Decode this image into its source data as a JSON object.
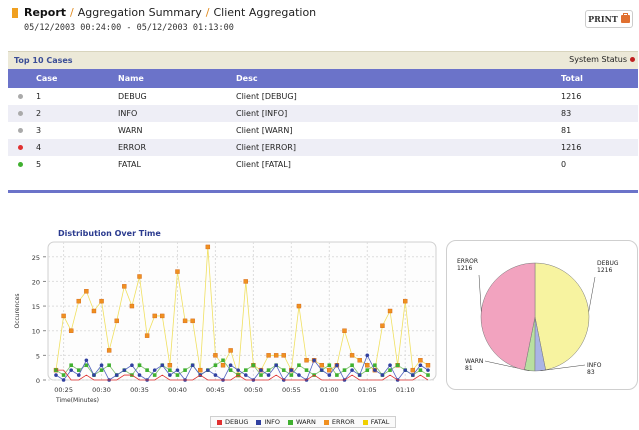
{
  "header": {
    "report_label": "Report",
    "crumb1": "Aggregation Summary",
    "crumb2": "Client Aggregation",
    "date_range": "05/12/2003 00:24:00 - 05/12/2003 01:13:00",
    "print_label": "PRINT",
    "accent_color": "#e08a1e"
  },
  "top_panel": {
    "title": "Top 10 Cases",
    "system_status_label": "System Status",
    "columns": [
      "Case",
      "Name",
      "Desc",
      "Total"
    ],
    "rows": [
      {
        "case": "1",
        "name": "DEBUG",
        "desc": "Client [DEBUG]",
        "total": "1216",
        "status_color": "#aaaaaa"
      },
      {
        "case": "2",
        "name": "INFO",
        "desc": "Client [INFO]",
        "total": "83",
        "status_color": "#aaaaaa"
      },
      {
        "case": "3",
        "name": "WARN",
        "desc": "Client [WARN]",
        "total": "81",
        "status_color": "#aaaaaa"
      },
      {
        "case": "4",
        "name": "ERROR",
        "desc": "Client [ERROR]",
        "total": "1216",
        "status_color": "#e03030"
      },
      {
        "case": "5",
        "name": "FATAL",
        "desc": "Client [FATAL]",
        "total": "0",
        "status_color": "#40b030"
      }
    ]
  },
  "charts_section": {
    "dist_title": "Distribution Over Time"
  },
  "chart_data": [
    {
      "type": "line",
      "title": "Distribution Over Time",
      "xlabel": "Time(Minutes)",
      "ylabel": "Occurences",
      "x_ticks": [
        "00:25",
        "00:30",
        "00:35",
        "00:40",
        "00:45",
        "00:50",
        "00:55",
        "01:00",
        "01:05",
        "01:10"
      ],
      "y_ticks": [
        0,
        5,
        10,
        15,
        20,
        25
      ],
      "ylim": [
        0,
        28
      ],
      "xlim": [
        0,
        49
      ],
      "grid": true,
      "legend_placement": "bottom",
      "series": [
        {
          "name": "DEBUG",
          "color": "#e03030",
          "values": [
            2,
            2,
            0,
            0,
            1,
            0,
            0,
            0,
            0,
            1,
            1,
            0,
            0,
            0,
            1,
            0,
            0,
            0,
            0,
            1,
            0,
            0,
            0,
            0,
            1,
            0,
            0,
            0,
            0,
            1,
            0,
            0,
            0,
            0,
            1,
            0,
            0,
            0,
            0,
            1,
            0,
            0,
            0,
            0,
            1,
            0,
            0,
            0,
            1,
            0
          ]
        },
        {
          "name": "INFO",
          "color": "#3040a0",
          "values": [
            1,
            0,
            2,
            1,
            4,
            1,
            3,
            0,
            1,
            2,
            3,
            1,
            0,
            2,
            3,
            1,
            2,
            0,
            3,
            1,
            2,
            1,
            0,
            3,
            2,
            1,
            0,
            2,
            1,
            3,
            0,
            2,
            1,
            0,
            4,
            2,
            1,
            3,
            0,
            2,
            1,
            5,
            2,
            1,
            3,
            0,
            2,
            1,
            3,
            2
          ]
        },
        {
          "name": "WARN",
          "color": "#40b030",
          "values": [
            2,
            1,
            3,
            2,
            3,
            1,
            2,
            3,
            1,
            2,
            1,
            3,
            2,
            1,
            3,
            2,
            1,
            2,
            3,
            1,
            2,
            3,
            4,
            2,
            1,
            2,
            3,
            1,
            2,
            3,
            2,
            1,
            3,
            2,
            1,
            2,
            3,
            1,
            2,
            3,
            1,
            2,
            3,
            1,
            2,
            3,
            2,
            1,
            2,
            1
          ]
        },
        {
          "name": "ERROR",
          "color": "#f09020",
          "values": [
            2,
            13,
            10,
            16,
            18,
            14,
            16,
            6,
            12,
            19,
            15,
            21,
            9,
            13,
            13,
            3,
            22,
            12,
            12,
            2,
            27,
            5,
            3,
            6,
            1,
            20,
            3,
            2,
            5,
            5,
            5,
            2,
            15,
            4,
            4,
            3,
            2,
            3,
            10,
            5,
            4,
            3,
            2,
            11,
            14,
            3,
            16,
            2,
            4,
            3
          ]
        },
        {
          "name": "FATAL",
          "color": "#f0d000",
          "values": [
            0,
            0,
            0,
            0,
            0,
            0,
            0,
            0,
            0,
            0,
            0,
            0,
            0,
            0,
            0,
            0,
            0,
            0,
            0,
            0,
            0,
            0,
            0,
            0,
            0,
            0,
            0,
            0,
            0,
            0,
            0,
            0,
            0,
            0,
            0,
            0,
            0,
            0,
            0,
            0,
            0,
            0,
            0,
            0,
            0,
            0,
            0,
            0,
            0,
            0
          ]
        }
      ]
    },
    {
      "type": "pie",
      "labels": [
        "DEBUG",
        "INFO",
        "WARN",
        "ERROR"
      ],
      "values": [
        1216,
        83,
        81,
        1216
      ],
      "colors": [
        "#f7f3a0",
        "#aab4e6",
        "#b8e0a0",
        "#f2a3bf"
      ]
    }
  ]
}
